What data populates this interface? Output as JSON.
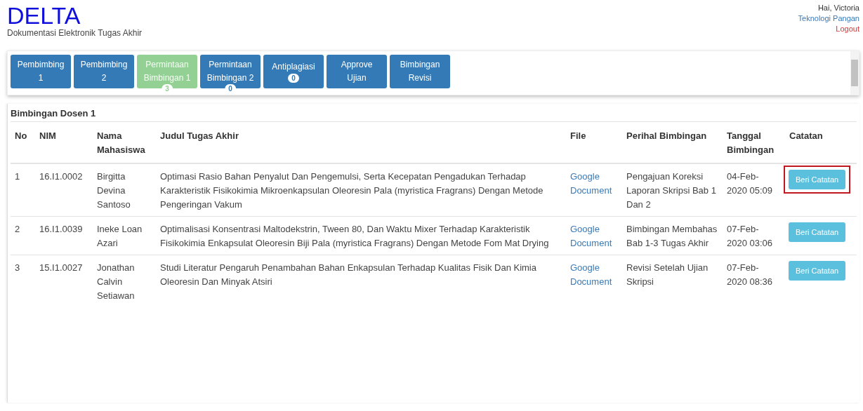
{
  "header": {
    "logo": "DELTA",
    "subtitle": "Dokumentasi Elektronik Tugas Akhir",
    "greeting": "Hai, Victoria",
    "department": "Teknologi Pangan",
    "logout": "Logout"
  },
  "tabs": [
    {
      "label": "Pembimbing 1",
      "selected": false
    },
    {
      "label": "Pembimbing 2",
      "selected": false
    },
    {
      "label": "Permintaan Bimbingan 1",
      "selected": true,
      "badge": "3",
      "kind": "overlap"
    },
    {
      "label": "Permintaan Bimbingan 2",
      "selected": false,
      "badge": "0",
      "kind": "overlap"
    },
    {
      "label": "Antiplagiasi",
      "selected": false,
      "badge": "0",
      "kind": "inline"
    },
    {
      "label": "Approve Ujian",
      "selected": false
    },
    {
      "label": "Bimbingan Revisi",
      "selected": false
    }
  ],
  "table": {
    "title": "Bimbingan Dosen 1",
    "columns": [
      "No",
      "NIM",
      "Nama Mahasiswa",
      "Judul Tugas Akhir",
      "File",
      "Perihal Bimbingan",
      "Tanggal Bimbingan",
      "Catatan"
    ],
    "rows": [
      {
        "no": "1",
        "nim": "16.I1.0002",
        "nama": "Birgitta Devina Santoso",
        "judul": "Optimasi Rasio Bahan Penyalut Dan Pengemulsi, Serta Kecepatan Pengadukan Terhadap Karakteristik Fisikokimia Mikroenkapsulan Oleoresin Pala (myristica Fragrans) Dengan Metode Pengeringan Vakum",
        "file": "Google Document",
        "perihal": "Pengajuan Koreksi Laporan Skripsi Bab 1 Dan 2",
        "tanggal": "04-Feb-2020 05:09",
        "action": "Beri Catatan",
        "highlighted": true
      },
      {
        "no": "2",
        "nim": "16.I1.0039",
        "nama": "Ineke Loan Azari",
        "judul": "Optimalisasi Konsentrasi Maltodekstrin, Tween 80, Dan Waktu Mixer Terhadap Karakteristik Fisikokimia Enkapsulat Oleoresin Biji Pala (myristica Fragrans) Dengan Metode Fom Mat Drying",
        "file": "Google Document",
        "perihal": "Bimbingan Membahas Bab 1-3 Tugas Akhir",
        "tanggal": "07-Feb-2020 03:06",
        "action": "Beri Catatan",
        "highlighted": false
      },
      {
        "no": "3",
        "nim": "15.I1.0027",
        "nama": "Jonathan Calvin Setiawan",
        "judul": "Studi Literatur Pengaruh Penambahan Bahan Enkapsulan Terhadap Kualitas Fisik Dan Kimia Oleoresin Dan Minyak Atsiri",
        "file": "Google Document",
        "perihal": "Revisi Setelah Ujian Skripsi",
        "tanggal": "07-Feb-2020 08:36",
        "action": "Beri Catatan",
        "highlighted": false
      }
    ]
  }
}
